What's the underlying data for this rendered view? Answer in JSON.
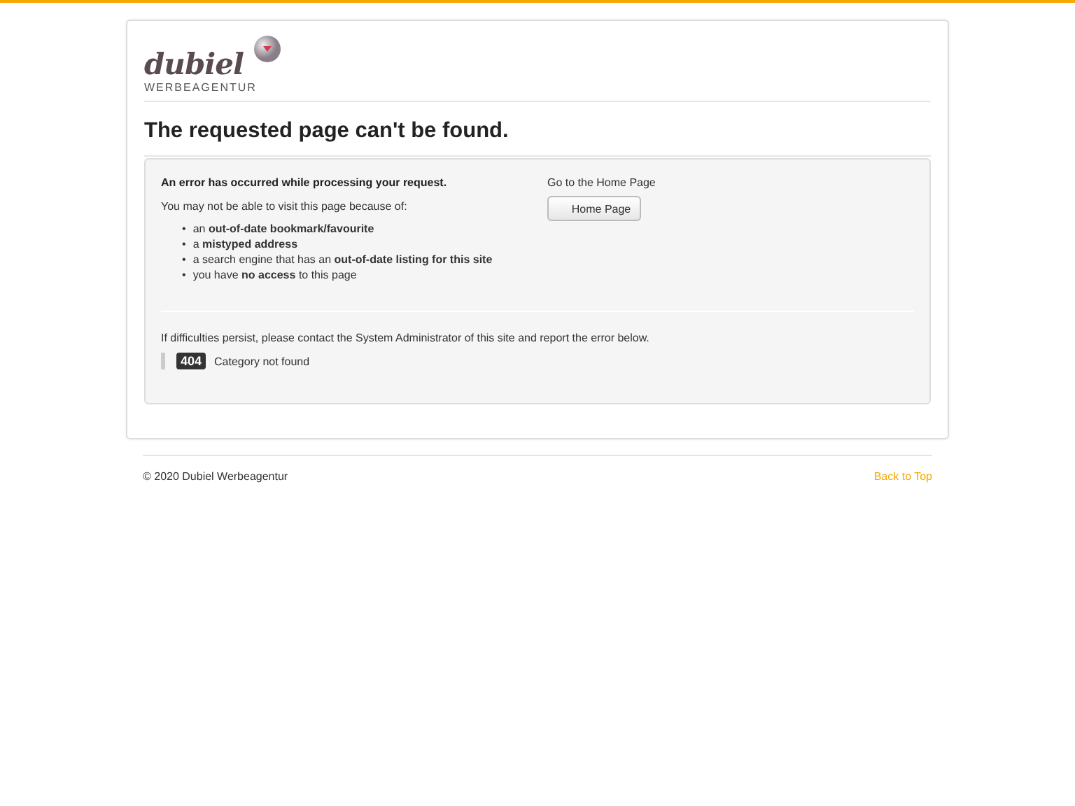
{
  "logo": {
    "wordmark": "dubiel",
    "tagline": "WERBEAGENTUR"
  },
  "heading": "The requested page can't be found.",
  "error": {
    "title": "An error has occurred while processing your request.",
    "intro": "You may not be able to visit this page because of:",
    "bullet": "•",
    "reasons": [
      "an **out-of-date bookmark/favourite**",
      "a **mistyped address**",
      "a search engine that has an **out-of-date listing for this site**",
      "you have **no access** to this page"
    ],
    "home_label": "Go to the Home Page",
    "home_button": "Home Page",
    "contact": "If difficulties persist, please contact the System Administrator of this site and report the error below.",
    "code": "404",
    "message": "Category not found"
  },
  "footer": {
    "copyright": "© 2020 Dubiel Werbeagentur",
    "back_to_top": "Back to Top"
  }
}
